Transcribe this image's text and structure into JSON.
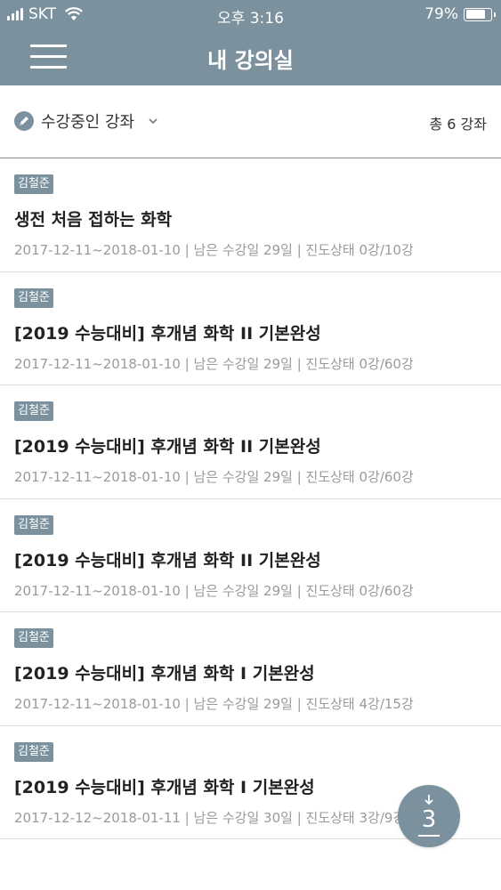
{
  "status_bar": {
    "carrier": "SKT",
    "time": "오후 3:16",
    "battery_text": "79%",
    "battery_level": 0.79
  },
  "header": {
    "title": "내 강의실",
    "menu_icon": "hamburger-menu-icon"
  },
  "filter": {
    "selected": "수강중인 강좌",
    "icon": "pencil-icon",
    "total_text": "총 6 강좌"
  },
  "courses": [
    {
      "instructor": "김철준",
      "title": "생전 처음 접하는 화학",
      "meta": "2017-12-11~2018-01-10 | 남은 수강일  29일 | 진도상태 0강/10강"
    },
    {
      "instructor": "김철준",
      "title": "[2019 수능대비] 후개념 화학 II 기본완성",
      "meta": "2017-12-11~2018-01-10 | 남은 수강일  29일 | 진도상태 0강/60강"
    },
    {
      "instructor": "김철준",
      "title": "[2019 수능대비] 후개념 화학 II 기본완성",
      "meta": "2017-12-11~2018-01-10 | 남은 수강일  29일 | 진도상태 0강/60강"
    },
    {
      "instructor": "김철준",
      "title": "[2019 수능대비] 후개념 화학 II 기본완성",
      "meta": "2017-12-11~2018-01-10 | 남은 수강일  29일 | 진도상태 0강/60강"
    },
    {
      "instructor": "김철준",
      "title": "[2019 수능대비] 후개념 화학 I 기본완성",
      "meta": "2017-12-11~2018-01-10 | 남은 수강일  29일 | 진도상태 4강/15강"
    },
    {
      "instructor": "김철준",
      "title": "[2019 수능대비] 후개념 화학 I 기본완성",
      "meta": "2017-12-12~2018-01-11 | 남은 수강일  30일 | 진도상태 3강/9강"
    }
  ],
  "fab": {
    "number": "3",
    "icon": "download-arrow-icon"
  },
  "colors": {
    "accent": "#7b919d",
    "meta_text": "#9a9a9a",
    "divider": "#dcdcdc"
  }
}
